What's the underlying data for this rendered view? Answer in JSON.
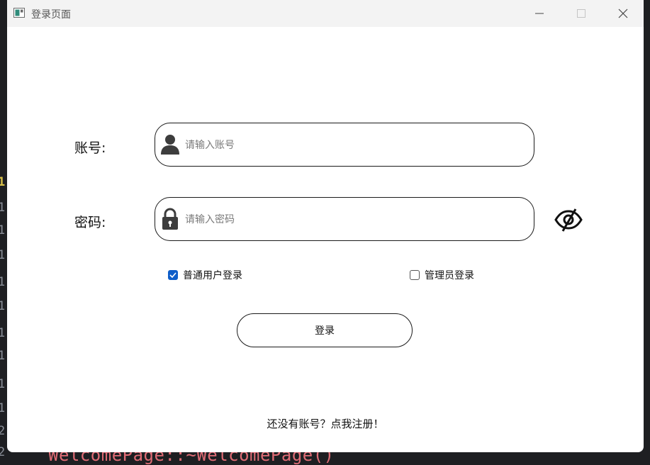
{
  "window": {
    "title": "登录页面"
  },
  "form": {
    "account_label": "账号:",
    "account_placeholder": "请输入账号",
    "account_value": "",
    "password_label": "密码:",
    "password_placeholder": "请输入密码",
    "password_value": ""
  },
  "options": [
    {
      "label": "普通用户登录",
      "checked": true
    },
    {
      "label": "管理员登录",
      "checked": false
    }
  ],
  "actions": {
    "login_label": "登录",
    "register_link": "还没有账号？点我注册！"
  },
  "background": {
    "line_numbers": [
      "1",
      "1",
      "1",
      "1",
      "1",
      "1",
      "1",
      "1",
      "1",
      "1",
      "1",
      "2",
      "2"
    ],
    "code_text": "WelcomePage::~WelcomePage()"
  },
  "colors": {
    "checkbox_accent": "#0f5ec9",
    "window_bg": "#ffffff",
    "titlebar_bg": "#f3f3f3"
  },
  "icons": {
    "account": "user-icon",
    "password": "lock-icon",
    "visibility": "eye-off-icon"
  }
}
